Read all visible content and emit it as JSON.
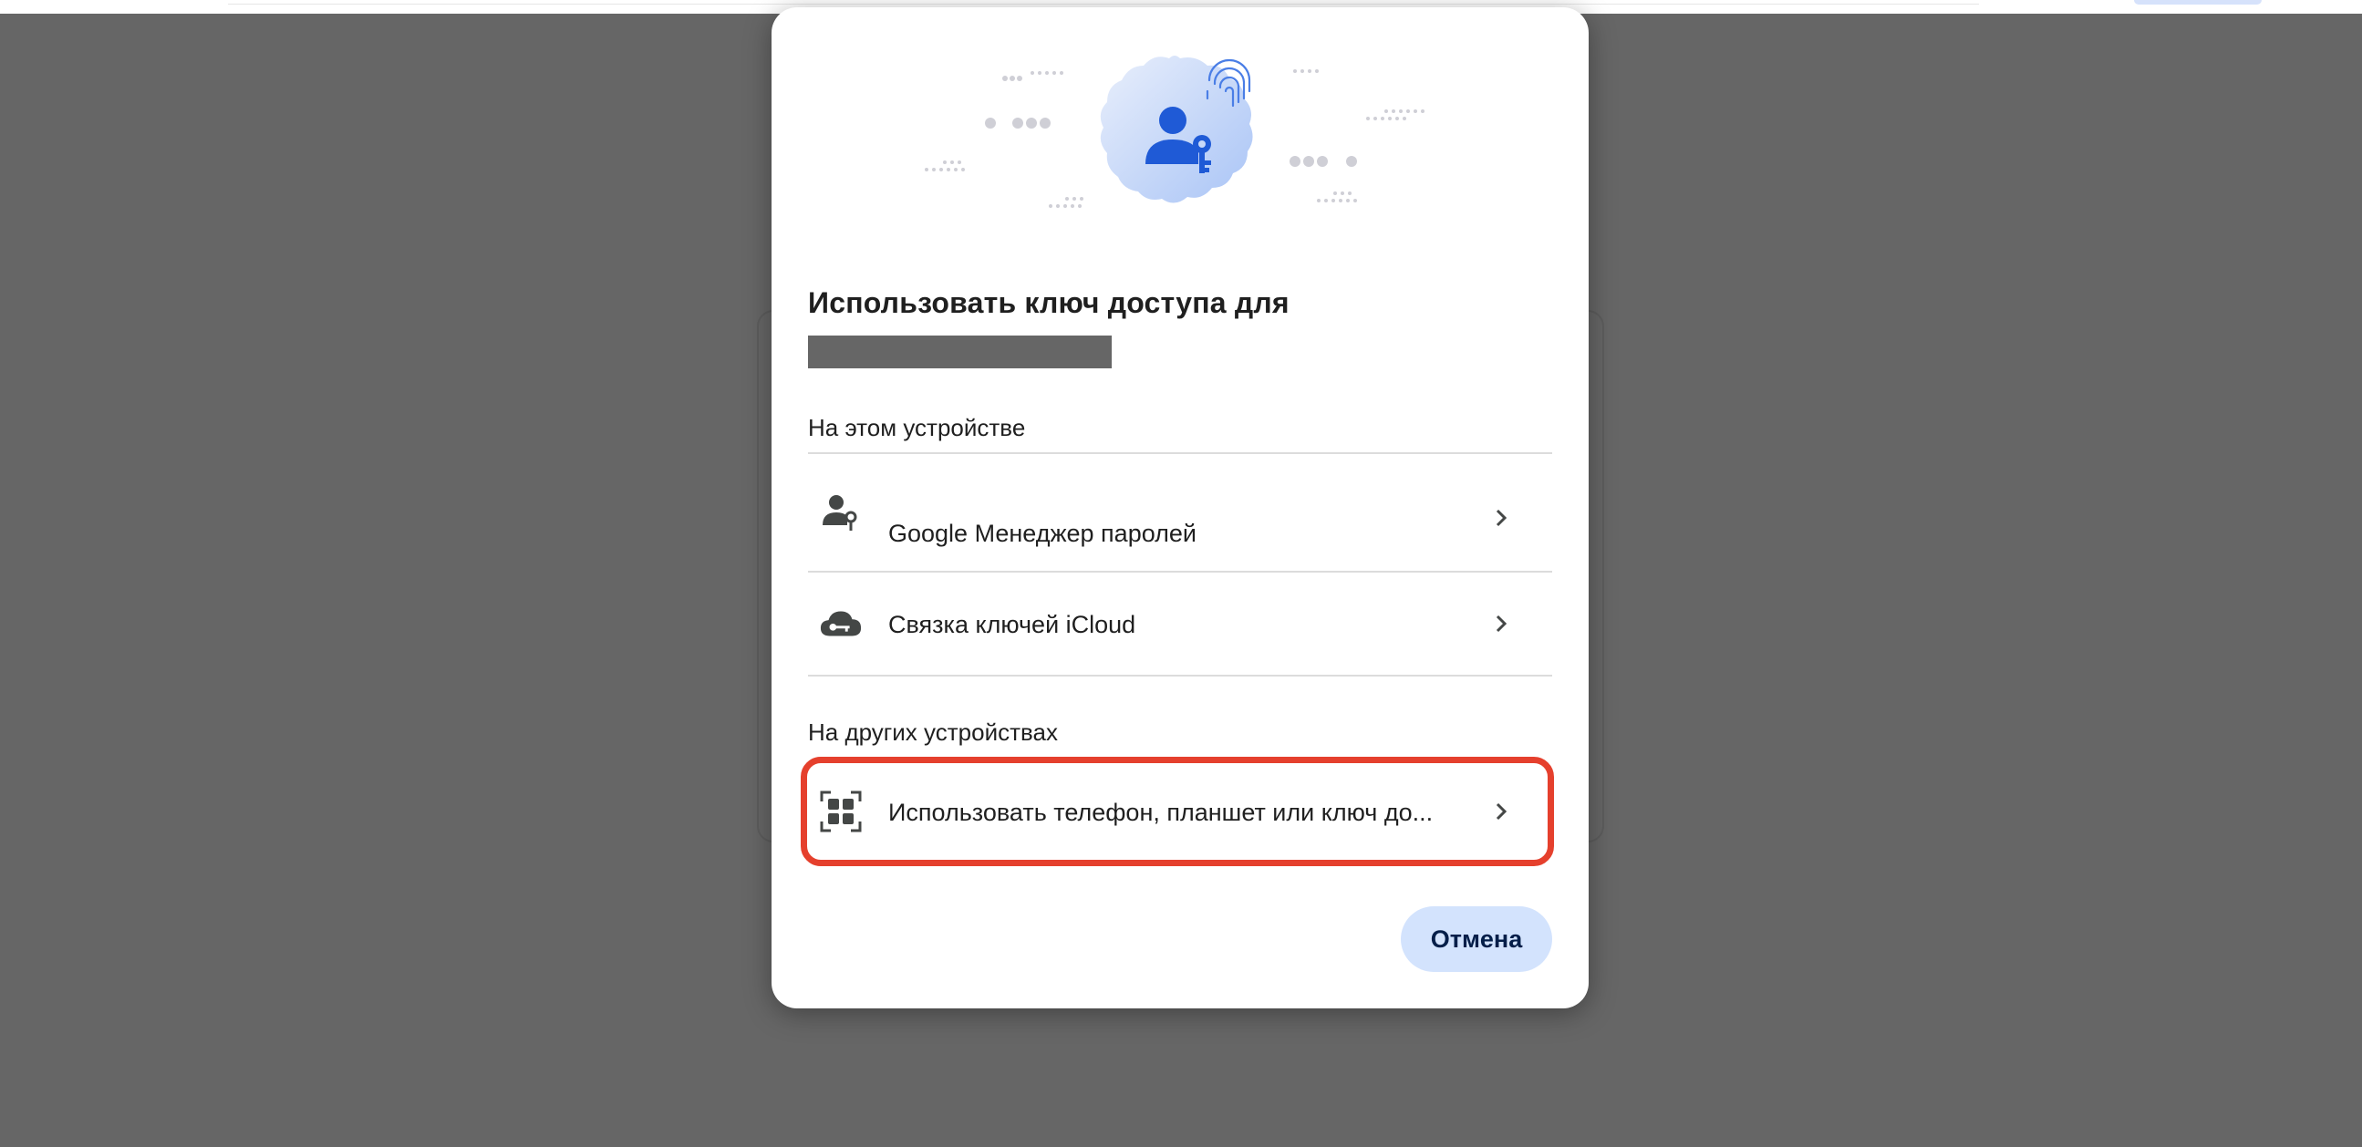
{
  "dialog": {
    "title": "Использовать ключ доступа для",
    "sections": {
      "this_device": "На этом устройстве",
      "other_devices": "На других устройствах"
    },
    "options": [
      {
        "label": "Google Менеджер паролей",
        "icon": "person-key-icon"
      },
      {
        "label": "Связка ключей iCloud",
        "icon": "cloud-key-icon"
      },
      {
        "label": "Использовать телефон, планшет или ключ до...",
        "icon": "qr-code-icon"
      }
    ],
    "cancel_label": "Отмена",
    "hero_icon": "passkey-user-fingerprint-icon"
  },
  "colors": {
    "overlay": "#666666",
    "accent_blue": "#1f5ad6",
    "highlight_red": "#e5402d",
    "cancel_bg": "#d3e3fd"
  }
}
